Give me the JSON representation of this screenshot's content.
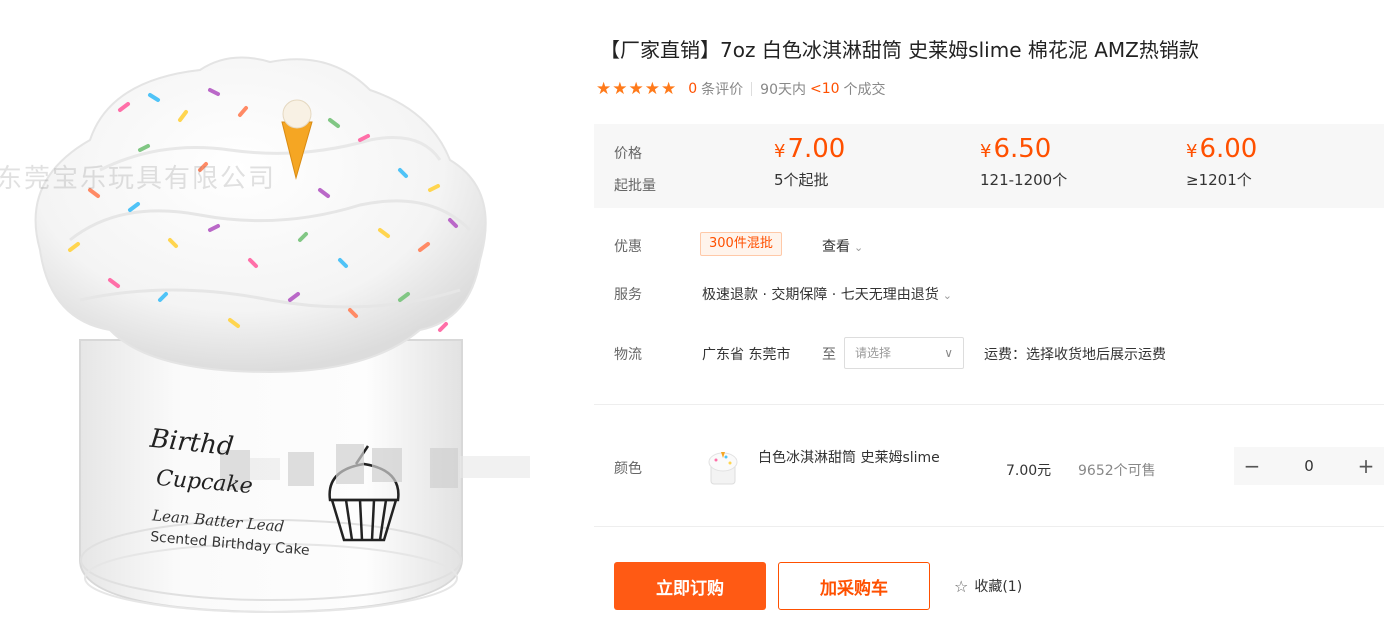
{
  "gallery": {
    "watermark": "东莞宝乐玩具有限公司",
    "jar_line1": "Birthd",
    "jar_line2": "Cupcake",
    "jar_line3": "Lean Batter Lead",
    "jar_line4": "Scented Birthday Cake"
  },
  "product": {
    "title": "【厂家直销】7oz 白色冰淇淋甜筒 史莱姆slime 棉花泥 AMZ热销款",
    "star_count": 5,
    "reviews_count": "0",
    "reviews_suffix": "条评价",
    "deals_prefix": "90天内",
    "deals_value": "<10",
    "deals_suffix": "个成交"
  },
  "pricing": {
    "price_label": "价格",
    "moq_label": "起批量",
    "currency": "¥",
    "tiers": [
      {
        "price": "7.00",
        "qty": "5个起批"
      },
      {
        "price": "6.50",
        "qty": "121-1200个"
      },
      {
        "price": "6.00",
        "qty": "≥1201个"
      }
    ]
  },
  "promo": {
    "label": "优惠",
    "tag": "300件混批",
    "view": "查看"
  },
  "service": {
    "label": "服务",
    "text": "极速退款 · 交期保障 · 七天无理由退货"
  },
  "logistics": {
    "label": "物流",
    "origin": "广东省 东莞市",
    "to": "至",
    "select_placeholder": "请选择",
    "fee": "运费：选择收货地后展示运费"
  },
  "color_option": {
    "label": "颜色",
    "name": "白色冰淇淋甜筒 史莱姆slime",
    "price": "7.00元",
    "stock": "9652个可售",
    "quantity": "0",
    "minus": "−",
    "plus": "+"
  },
  "actions": {
    "buy": "立即订购",
    "cart": "加采购车",
    "favorite": "收藏(1)"
  },
  "colors": {
    "accent": "#ff5000",
    "buy_bg": "#ff5a14",
    "star": "#ff7a1a"
  }
}
